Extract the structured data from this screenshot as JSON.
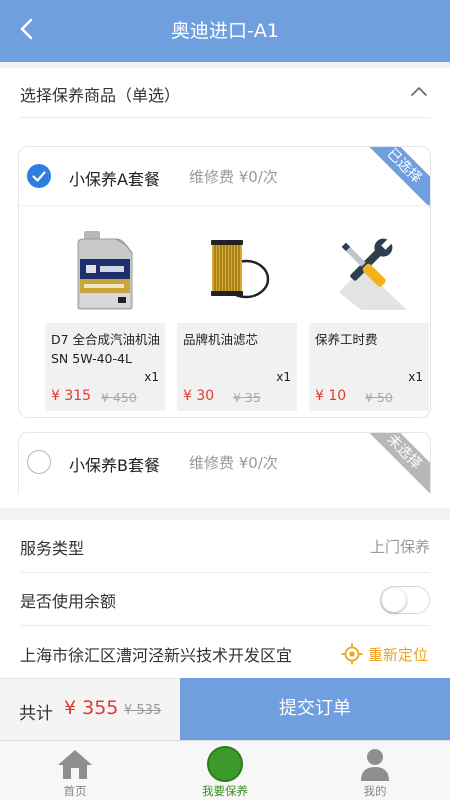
{
  "header": {
    "title": "奥迪进口-A1"
  },
  "select_section": {
    "title": "选择保养商品（单选）"
  },
  "packages": [
    {
      "name": "小保养A套餐",
      "fee": "维修费 ¥0/次",
      "ribbon": "已选择",
      "selected": true,
      "items": [
        {
          "name": "D7 全合成汽油机油 SN 5W-40-4L",
          "qty": "x1",
          "price": "¥ 315",
          "old_price": "¥ 450",
          "image": "engine-oil-bottle-icon"
        },
        {
          "name": "品牌机油滤芯",
          "qty": "x1",
          "price": "¥ 30",
          "old_price": "¥ 35",
          "image": "oil-filter-icon"
        },
        {
          "name": "保养工时费",
          "qty": "x1",
          "price": "¥ 10",
          "old_price": "¥ 50",
          "image": "tools-icon"
        }
      ]
    },
    {
      "name": "小保养B套餐",
      "fee": "维修费 ¥0/次",
      "ribbon": "未选择",
      "selected": false
    }
  ],
  "service": {
    "type_label": "服务类型",
    "type_value": "上门保养",
    "balance_label": "是否使用余额",
    "balance_enabled": false,
    "address": "上海市徐汇区漕河泾新兴技术开发区宜",
    "relocate": "重新定位"
  },
  "order": {
    "total_label": "共计",
    "total": "¥ 355",
    "original_total": "¥ 535",
    "submit": "提交订单"
  },
  "tabs": [
    {
      "label": "首页",
      "icon": "home-icon",
      "active": false
    },
    {
      "label": "我要保养",
      "icon": "green-circle-icon",
      "active": true
    },
    {
      "label": "我的",
      "icon": "user-icon",
      "active": false
    }
  ],
  "colors": {
    "primary": "#6f9fdf",
    "accent_red": "#e23a2e",
    "relocate_orange": "#f0a21e",
    "active_green": "#3b8e22"
  }
}
